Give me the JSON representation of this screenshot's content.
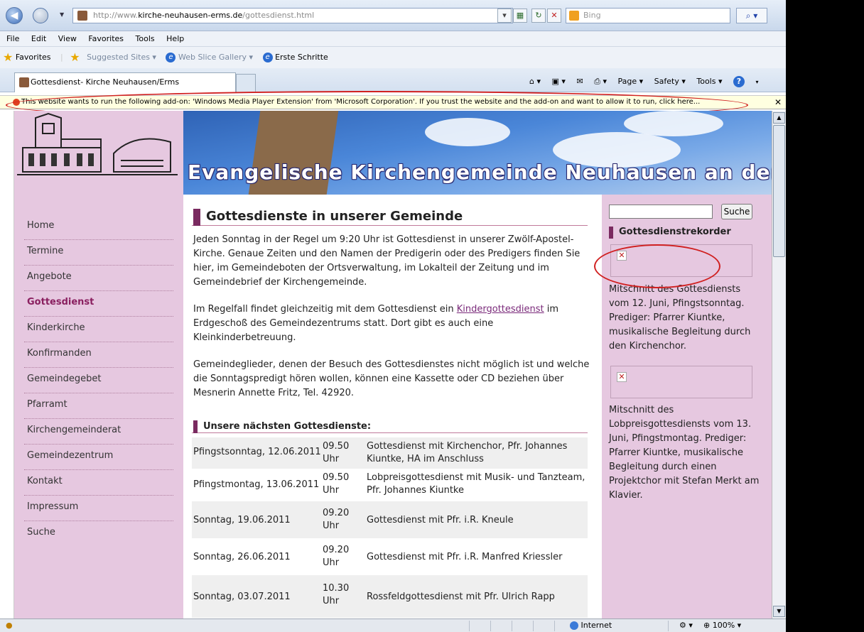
{
  "browser": {
    "url_prefix": "http://www.",
    "url_domain": "kirche-neuhausen-erms.de",
    "url_path": "/gottesdienst.html",
    "search_placeholder": "Bing",
    "menu": [
      "File",
      "Edit",
      "View",
      "Favorites",
      "Tools",
      "Help"
    ],
    "favorites_label": "Favorites",
    "favorites_items": [
      "Suggested Sites ▾",
      "Web Slice Gallery ▾",
      "Erste Schritte"
    ],
    "tab_title": "Gottesdienst- Kirche Neuhausen/Erms",
    "commands": [
      "Page ▾",
      "Safety ▾",
      "Tools ▾"
    ],
    "infobar_text": "This website wants to run the following add-on: 'Windows Media Player Extension' from 'Microsoft Corporation'. If you trust the website and the add-on and want to allow it to run, click here...",
    "status_zone": "Internet",
    "status_zoom": "100%"
  },
  "site": {
    "banner_title": "Evangelische Kirchengemeinde Neuhausen an der Erms",
    "nav": [
      "Home",
      "Termine",
      "Angebote",
      "Gottesdienst",
      "Kinderkirche",
      "Konfirmanden",
      "Gemeindegebet",
      "Pfarramt",
      "Kirchengemeinderat",
      "Gemeindezentrum",
      "Kontakt",
      "Impressum",
      "Suche"
    ],
    "nav_active": "Gottesdienst"
  },
  "main": {
    "heading": "Gottesdienste in unserer Gemeinde",
    "p1": "Jeden Sonntag in der Regel um 9:20 Uhr ist Gottesdienst in unserer Zwölf-Apostel-Kirche. Genaue Zeiten und den Namen der Predigerin oder des Predigers finden Sie hier, im Gemeindeboten der Ortsverwaltung, im Lokalteil der Zeitung und im Gemeindebrief der Kirchengemeinde.",
    "p2_before": "Im Regelfall findet gleichzeitig mit dem Gottesdienst ein ",
    "p2_link": "Kindergottesdienst",
    "p2_after": " im Erdgeschoß des Gemeindezentrums statt. Dort gibt es auch eine Kleinkinderbetreuung.",
    "p3": "Gemeindeglieder, denen der Besuch des Gottesdienstes nicht möglich ist und welche die Sonntagspredigt hören wollen, können eine Kassette oder CD beziehen über Mesnerin Annette Fritz, Tel. 42920.",
    "subheading": "Unsere nächsten Gottesdienste:",
    "services": [
      {
        "date": "Pfingstsonntag, 12.06.2011",
        "time": "09.50 Uhr",
        "desc": "Gottesdienst mit Kirchenchor, Pfr. Johannes Kiuntke, HA im Anschluss"
      },
      {
        "date": "Pfingstmontag, 13.06.2011",
        "time": "09.50 Uhr",
        "desc": "Lobpreisgottesdienst mit Musik- und Tanzteam, Pfr. Johannes Kiuntke"
      },
      {
        "date": "Sonntag, 19.06.2011",
        "time": "09.20 Uhr",
        "desc": "Gottesdienst mit Pfr. i.R. Kneule"
      },
      {
        "date": "Sonntag, 26.06.2011",
        "time": "09.20 Uhr",
        "desc": "Gottesdienst mit Pfr. i.R. Manfred Kriessler"
      },
      {
        "date": "Sonntag, 03.07.2011",
        "time": "10.30 Uhr",
        "desc": "Rossfeldgottesdienst mit Pfr. Ulrich Rapp"
      }
    ]
  },
  "sidebar": {
    "search_button": "Suche",
    "title": "Gottesdienstrekorder",
    "rec1": "Mitschnitt des Gottesdiensts vom 12. Juni, Pfingstsonntag. Prediger: Pfarrer Kiuntke, musikalische Begleitung durch den Kirchenchor.",
    "rec2": "Mitschnitt des Lobpreisgottesdiensts vom 13. Juni, Pfingstmontag. Prediger: Pfarrer Kiuntke, musikalische Begleitung durch einen Projektchor mit Stefan Merkt am Klavier."
  }
}
